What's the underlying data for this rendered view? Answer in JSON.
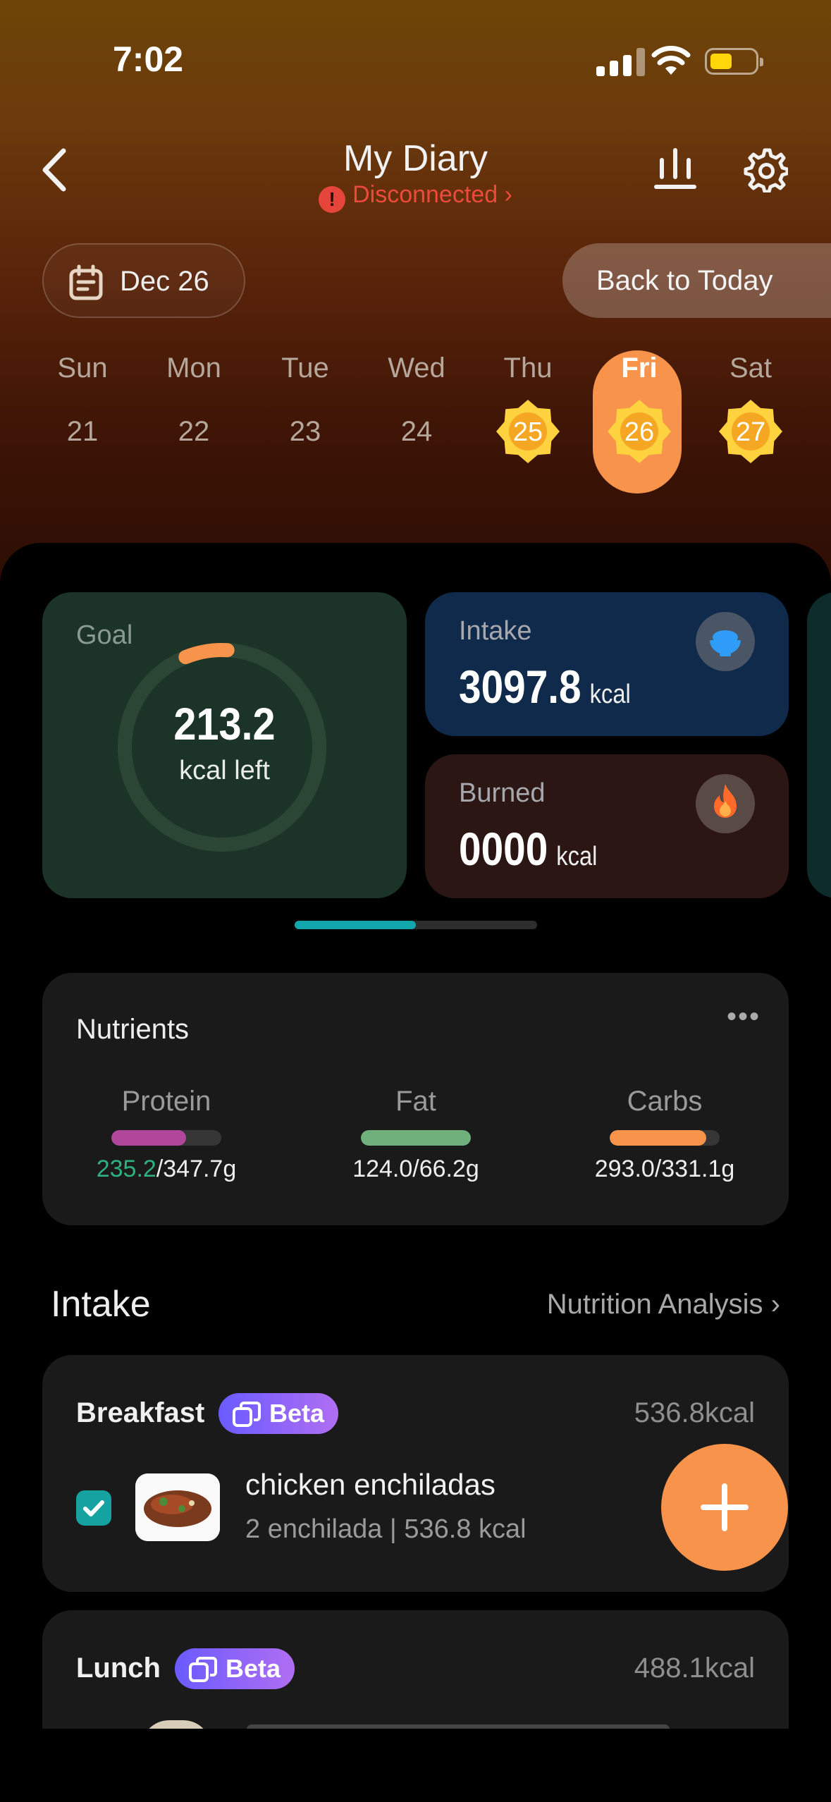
{
  "status_bar": {
    "time": "7:02"
  },
  "header": {
    "title": "My Diary",
    "connection_status": "Disconnected",
    "connection_alert_glyph": "!",
    "connection_chevron": "›",
    "back_glyph": "‹"
  },
  "date_picker": {
    "current_date": "Dec 26",
    "back_to_today_label": "Back to Today"
  },
  "week": [
    {
      "name": "Sun",
      "date": "21",
      "badge": false,
      "selected": false
    },
    {
      "name": "Mon",
      "date": "22",
      "badge": false,
      "selected": false
    },
    {
      "name": "Tue",
      "date": "23",
      "badge": false,
      "selected": false
    },
    {
      "name": "Wed",
      "date": "24",
      "badge": false,
      "selected": false
    },
    {
      "name": "Thu",
      "date": "25",
      "badge": true,
      "selected": false
    },
    {
      "name": "Fri",
      "date": "26",
      "badge": true,
      "selected": true
    },
    {
      "name": "Sat",
      "date": "27",
      "badge": true,
      "selected": false
    }
  ],
  "goal": {
    "label": "Goal",
    "value": "213.2",
    "unit": "kcal left",
    "progress_fraction": 0.07
  },
  "intake": {
    "label": "Intake",
    "value": "3097.8",
    "unit": "kcal",
    "icon": "rice-bowl-icon"
  },
  "burned": {
    "label": "Burned",
    "value": "0000",
    "unit": "kcal",
    "icon": "flame-icon"
  },
  "pager": {
    "pages": 2,
    "active": 1
  },
  "nutrients": {
    "title": "Nutrients",
    "more_glyph": "•••",
    "items": [
      {
        "name": "Protein",
        "consumed": "235.2",
        "goal": "/347.7g",
        "fraction": 0.68,
        "color": "#b0479b"
      },
      {
        "name": "Fat",
        "value": "124.0/66.2g",
        "fraction": 1.0,
        "color": "#6fb07d"
      },
      {
        "name": "Carbs",
        "value": "293.0/331.1g",
        "fraction": 0.88,
        "color": "#f7934b"
      }
    ]
  },
  "intake_section": {
    "title": "Intake",
    "analysis_link": "Nutrition Analysis",
    "chevron": "›"
  },
  "meals": {
    "breakfast": {
      "name": "Breakfast",
      "badge": "Beta",
      "kcal": "536.8kcal",
      "food": {
        "name": "chicken enchiladas",
        "detail": "2 enchilada | 536.8 kcal",
        "checked": true
      }
    },
    "lunch": {
      "name": "Lunch",
      "badge": "Beta",
      "kcal": "488.1kcal"
    }
  },
  "colors": {
    "accent": "#f7934b",
    "teal": "#17a2a2",
    "alert": "#e5453b"
  }
}
